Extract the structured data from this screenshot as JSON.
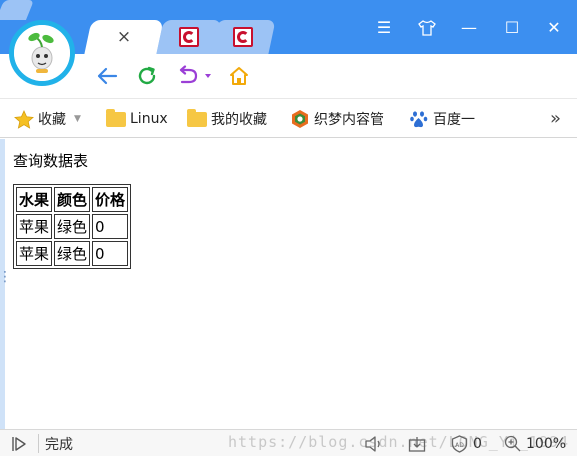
{
  "tabs": [
    {
      "name": "new-tab",
      "close_symbol": "×"
    },
    {
      "name": "csdn-tab-1"
    },
    {
      "name": "csdn-tab-2"
    }
  ],
  "window_controls": {
    "menu": "☰",
    "skin": "skin-icon",
    "minimize": "—",
    "maximize": "☐",
    "close": "✕"
  },
  "bookmarks": {
    "items": [
      {
        "label": "收藏",
        "icon": "star-icon"
      },
      {
        "label": "Linux",
        "icon": "folder-icon"
      },
      {
        "label": "我的收藏",
        "icon": "folder-icon"
      },
      {
        "label": "织梦内容管",
        "icon": "dedecms-icon"
      },
      {
        "label": "百度一",
        "icon": "baidu-paw-icon"
      }
    ],
    "more": "»"
  },
  "page": {
    "heading": "查询数据表",
    "table": {
      "headers": [
        "水果",
        "颜色",
        "价格"
      ],
      "rows": [
        [
          "苹果",
          "绿色",
          "0"
        ],
        [
          "苹果",
          "绿色",
          "0"
        ]
      ]
    }
  },
  "status": {
    "text": "完成",
    "watermark": "https://blog.csdn.net/LONG_Yi_1994",
    "count": "0",
    "zoom": "100%"
  },
  "colors": {
    "titlebar": "#3c8ff0",
    "tab_inactive": "#9cc3f5",
    "avatar_ring": "#21b2e9",
    "back_arrow": "#3a86e6",
    "refresh": "#22aa44",
    "undo": "#9b3fd6",
    "home": "#f2a90a",
    "csdn_red": "#c8102e"
  }
}
